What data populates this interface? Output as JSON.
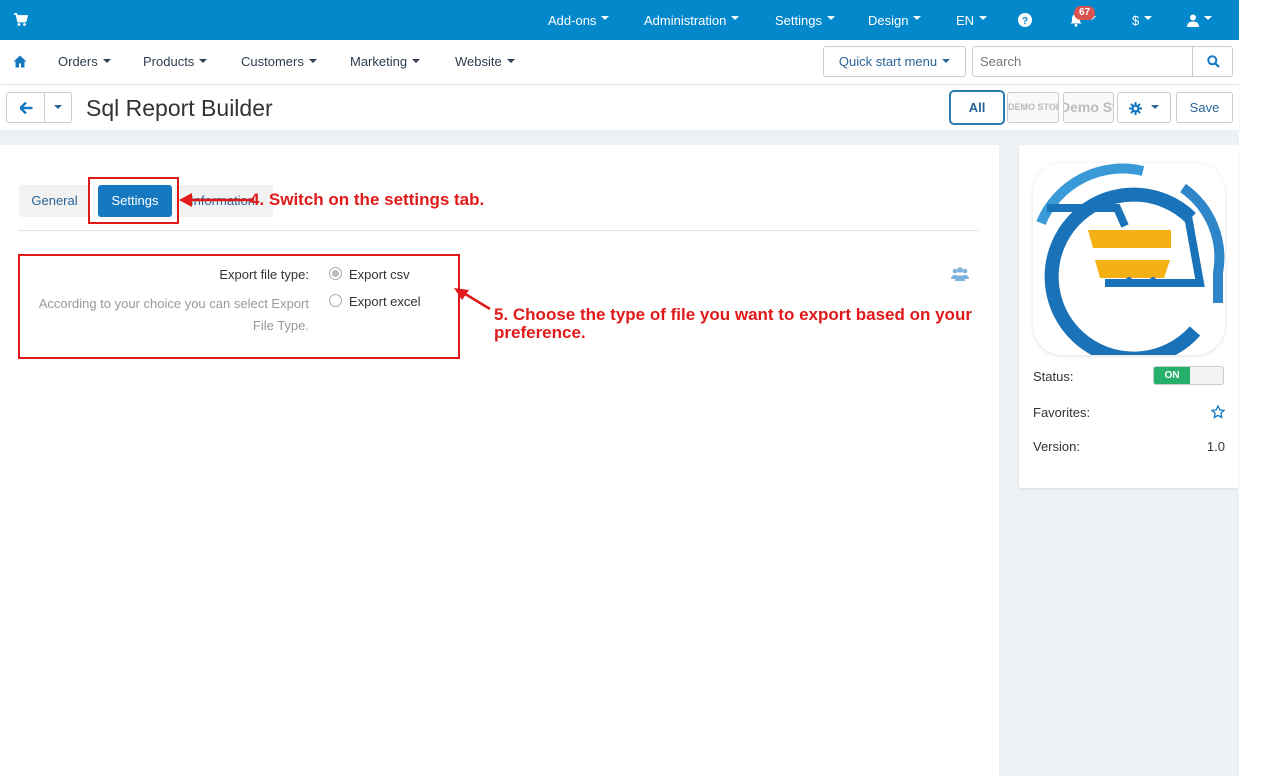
{
  "topbar": {
    "items": [
      "Add-ons",
      "Administration",
      "Settings",
      "Design",
      "EN"
    ],
    "notifications_count": "67",
    "currency": "$"
  },
  "menubar": {
    "items": [
      "Orders",
      "Products",
      "Customers",
      "Marketing",
      "Website"
    ],
    "quick_start": "Quick start menu",
    "search_placeholder": "Search"
  },
  "titlebar": {
    "title": "Sql Report Builder",
    "all_label": "All",
    "store1": "DEMO STORE",
    "store2": "Demo Store",
    "save_label": "Save"
  },
  "tabs": {
    "general": "General",
    "settings": "Settings",
    "information": "Information"
  },
  "form": {
    "label": "Export file type:",
    "description": "According to your choice you can select Export File Type.",
    "options": [
      {
        "label": "Export csv",
        "checked": true
      },
      {
        "label": "Export excel",
        "checked": false
      }
    ]
  },
  "annotations": {
    "step4": "4. Switch on the settings tab.",
    "step5": "5. Choose the type of file you want to export based on your preference.",
    "color": "#e01a1a"
  },
  "sidebar": {
    "status_label": "Status:",
    "status_value": "ON",
    "favorites_label": "Favorites:",
    "version_label": "Version:",
    "version_value": "1.0"
  },
  "colors": {
    "topbar": "#0388cc",
    "primary": "#1479c1",
    "status_on": "#27b06a",
    "logo_blue": "#1a73b8",
    "logo_yellow": "#f5b014"
  }
}
